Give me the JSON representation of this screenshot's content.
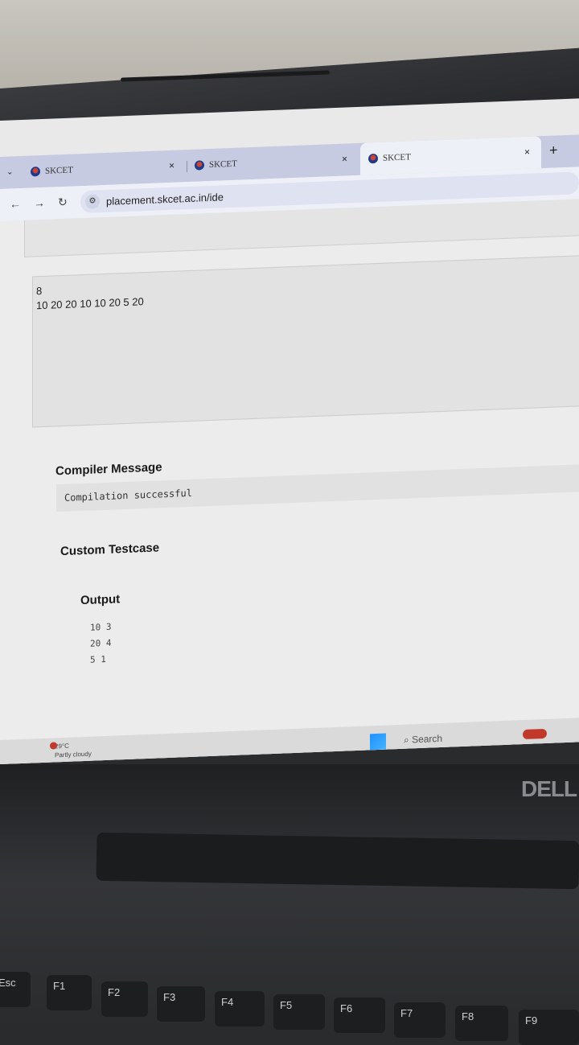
{
  "browser": {
    "tabs": [
      {
        "title": "SKCET",
        "close": "×"
      },
      {
        "title": "SKCET",
        "close": "×"
      },
      {
        "title": "SKCET",
        "close": "×"
      }
    ],
    "new_tab": "+",
    "url": "placement.skcet.ac.in/ide"
  },
  "ide": {
    "input_lines": [
      "8",
      "10 20 20 10 10 20 5 20"
    ],
    "compiler_message_heading": "Compiler Message",
    "compiler_message": "Compilation successful",
    "custom_testcase_heading": "Custom Testcase",
    "output_heading": "Output",
    "output_lines": [
      "10 3",
      "20 4",
      "5 1"
    ]
  },
  "taskbar": {
    "temperature": "29°C",
    "weather": "Partly cloudy",
    "search": "Search"
  },
  "laptop": {
    "brand": "DELL",
    "keys": [
      "Esc",
      "F1",
      "F2",
      "F3",
      "F4",
      "F5",
      "F6",
      "F7",
      "F8",
      "F9"
    ]
  }
}
